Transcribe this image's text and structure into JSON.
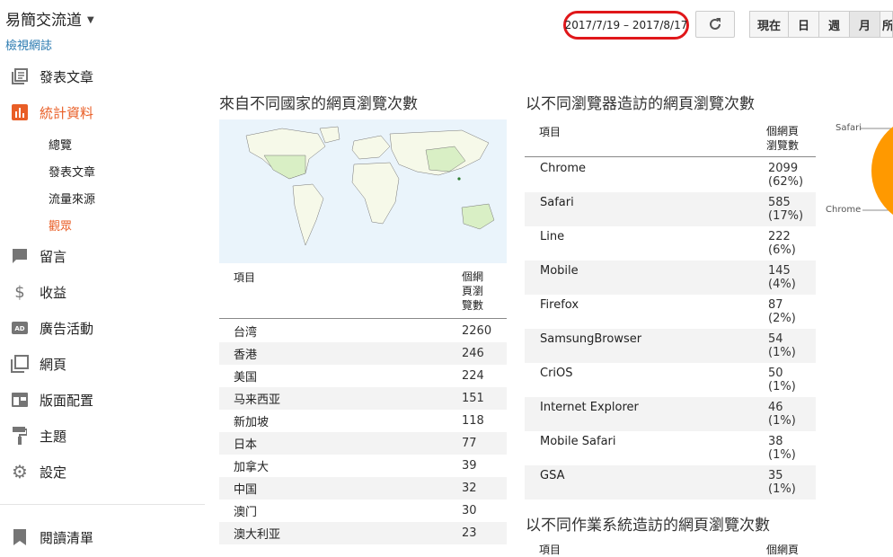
{
  "sidebar": {
    "blog_title": "易簡交流道",
    "view_blog": "檢視網誌",
    "items": [
      {
        "label": "發表文章",
        "icon": "posts-icon"
      },
      {
        "label": "統計資料",
        "icon": "stats-icon",
        "active": true
      },
      {
        "label": "留言",
        "icon": "comments-icon"
      },
      {
        "label": "收益",
        "icon": "dollar-icon"
      },
      {
        "label": "廣告活動",
        "icon": "ad-icon"
      },
      {
        "label": "網頁",
        "icon": "pages-icon"
      },
      {
        "label": "版面配置",
        "icon": "layout-icon"
      },
      {
        "label": "主題",
        "icon": "theme-roller-icon"
      },
      {
        "label": "設定",
        "icon": "gear-icon"
      },
      {
        "label": "閱讀清單",
        "icon": "bookmark-icon"
      }
    ],
    "stats_sub": [
      {
        "label": "總覽"
      },
      {
        "label": "發表文章"
      },
      {
        "label": "流量來源"
      },
      {
        "label": "觀眾",
        "active": true
      }
    ]
  },
  "toolbar": {
    "date_range": "2017/7/19 – 2017/8/17",
    "range_buttons": [
      "現在",
      "日",
      "週",
      "月",
      "所"
    ]
  },
  "countries": {
    "title": "來自不同國家的網頁瀏覽次數",
    "col_item": "項目",
    "col_views": "個網\n頁瀏\n覽數",
    "rows": [
      {
        "name": "台湾",
        "value": "2260"
      },
      {
        "name": "香港",
        "value": "246"
      },
      {
        "name": "美国",
        "value": "224"
      },
      {
        "name": "马来西亚",
        "value": "151"
      },
      {
        "name": "新加坡",
        "value": "118"
      },
      {
        "name": "日本",
        "value": "77"
      },
      {
        "name": "加拿大",
        "value": "39"
      },
      {
        "name": "中国",
        "value": "32"
      },
      {
        "name": "澳门",
        "value": "30"
      },
      {
        "name": "澳大利亚",
        "value": "23"
      }
    ]
  },
  "browsers": {
    "title": "以不同瀏覽器造訪的網頁瀏覽次數",
    "col_item": "項目",
    "col_views": "個網頁\n瀏覽數",
    "rows": [
      {
        "name": "Chrome",
        "value": "2099",
        "pct": "(62%)"
      },
      {
        "name": "Safari",
        "value": "585",
        "pct": "(17%)"
      },
      {
        "name": "Line",
        "value": "222",
        "pct": "(6%)"
      },
      {
        "name": "Mobile",
        "value": "145",
        "pct": "(4%)"
      },
      {
        "name": "Firefox",
        "value": "87",
        "pct": "(2%)"
      },
      {
        "name": "SamsungBrowser",
        "value": "54",
        "pct": "(1%)"
      },
      {
        "name": "CriOS",
        "value": "50",
        "pct": "(1%)"
      },
      {
        "name": "Internet Explorer",
        "value": "46",
        "pct": "(1%)"
      },
      {
        "name": "Mobile Safari",
        "value": "38",
        "pct": "(1%)"
      },
      {
        "name": "GSA",
        "value": "35",
        "pct": "(1%)"
      }
    ],
    "pie_labels": [
      "Safari",
      "Chrome"
    ],
    "pie_color": "#ff9900"
  },
  "os_section": {
    "title": "以不同作業系統造訪的網頁瀏覽次數",
    "col_item": "項目",
    "col_views": "個網頁"
  },
  "colors": {
    "accent": "#e95e26",
    "link": "#2a7ab0",
    "highlight": "#e0171a"
  }
}
